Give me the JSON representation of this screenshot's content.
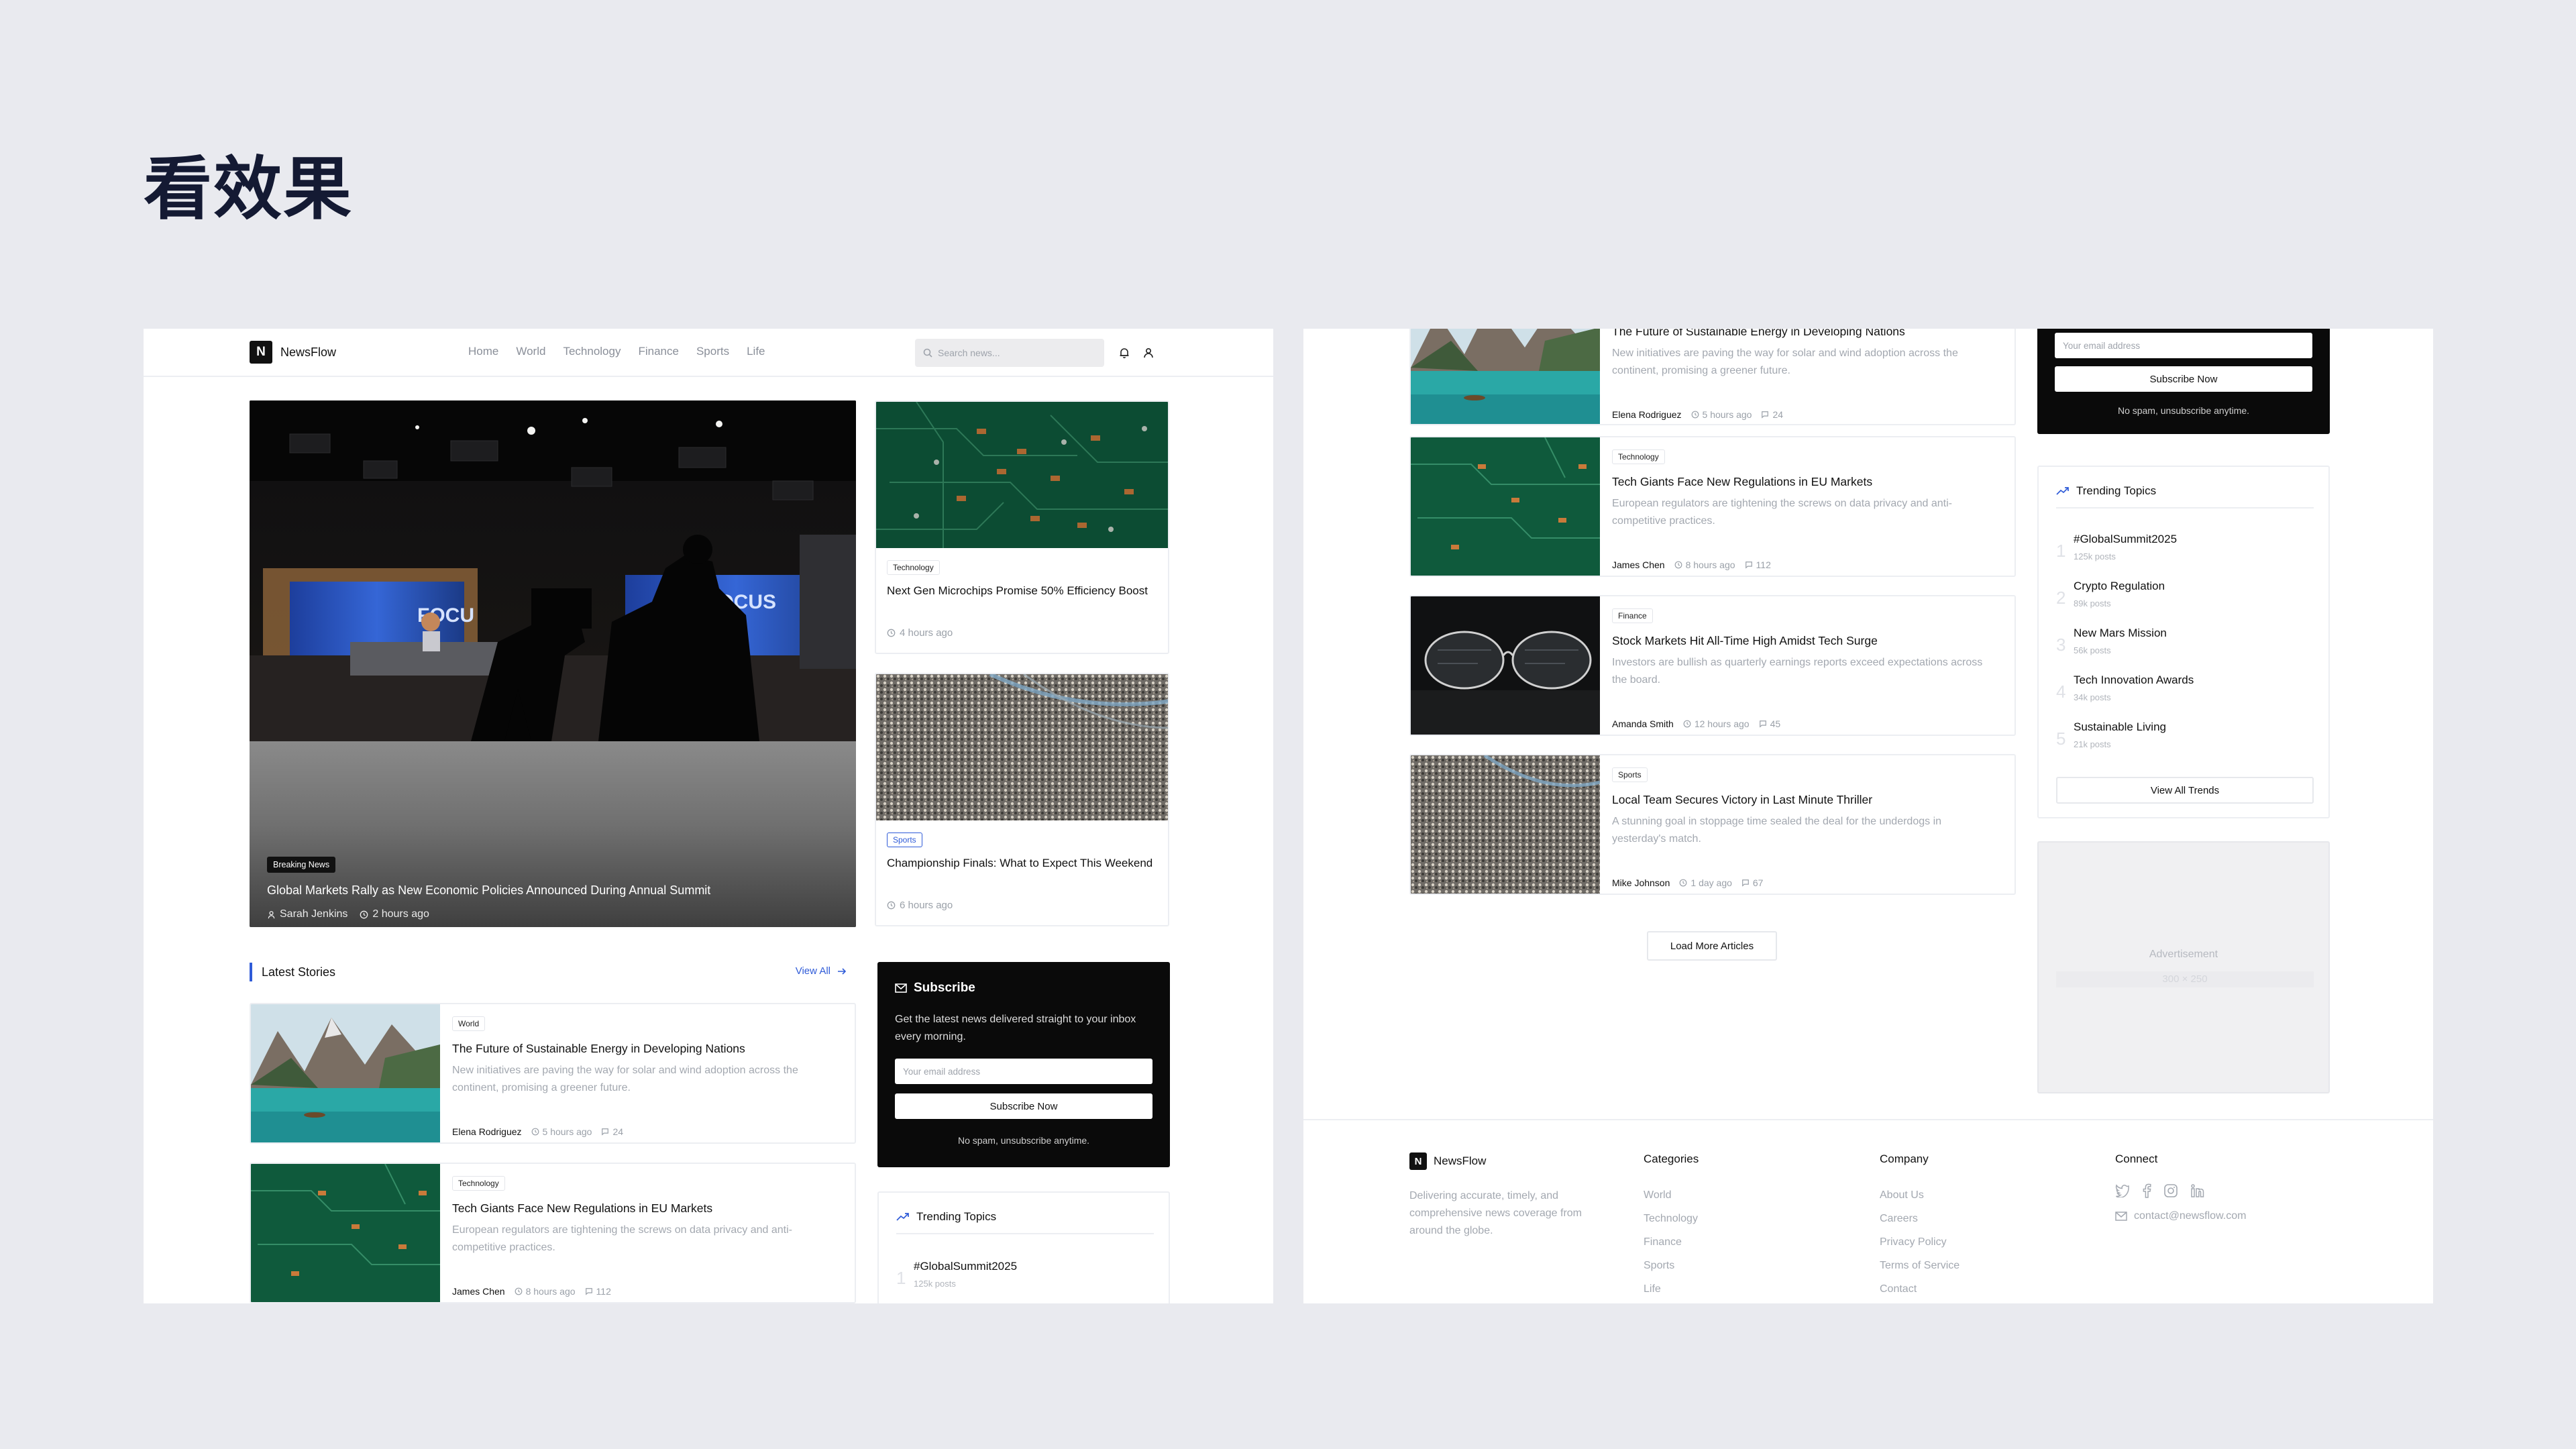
{
  "slide": {
    "title": "看效果"
  },
  "brand": {
    "logo_letter": "N",
    "name": "NewsFlow"
  },
  "nav": {
    "menu": [
      "Home",
      "World",
      "Technology",
      "Finance",
      "Sports",
      "Life"
    ],
    "search_placeholder": "Search news..."
  },
  "hero": {
    "badge": "Breaking News",
    "title": "Global Markets Rally as New Economic Policies Announced During Annual Summit",
    "author": "Sarah Jenkins",
    "time": "2 hours ago"
  },
  "side_cards": [
    {
      "tag": "Technology",
      "title": "Next Gen Microchips Promise 50% Efficiency Boost",
      "time": "4 hours ago"
    },
    {
      "tag": "Sports",
      "title": "Championship Finals: What to Expect This Weekend",
      "time": "6 hours ago"
    }
  ],
  "latest": {
    "heading": "Latest Stories",
    "view_all": "View All"
  },
  "articles": [
    {
      "tag": "World",
      "title": "The Future of Sustainable Energy in Developing Nations",
      "desc": "New initiatives are paving the way for solar and wind adoption across the continent, promising a greener future.",
      "author": "Elena Rodriguez",
      "time": "5 hours ago",
      "comments": "24"
    },
    {
      "tag": "Technology",
      "title": "Tech Giants Face New Regulations in EU Markets",
      "desc": "European regulators are tightening the screws on data privacy and anti-competitive practices.",
      "author": "James Chen",
      "time": "8 hours ago",
      "comments": "112"
    },
    {
      "tag": "Finance",
      "title": "Stock Markets Hit All-Time High Amidst Tech Surge",
      "desc": "Investors are bullish as quarterly earnings reports exceed expectations across the board.",
      "author": "Amanda Smith",
      "time": "12 hours ago",
      "comments": "45"
    },
    {
      "tag": "Sports",
      "title": "Local Team Secures Victory in Last Minute Thriller",
      "desc": "A stunning goal in stoppage time sealed the deal for the underdogs in yesterday's match.",
      "author": "Mike Johnson",
      "time": "1 day ago",
      "comments": "67"
    }
  ],
  "subscribe": {
    "heading": "Subscribe",
    "text": "Get the latest news delivered straight to your inbox every morning.",
    "email_placeholder": "Your email address",
    "button": "Subscribe Now",
    "note": "No spam, unsubscribe anytime."
  },
  "trending": {
    "heading": "Trending Topics",
    "items": [
      {
        "rank": "1",
        "name": "#GlobalSummit2025",
        "posts": "125k posts"
      },
      {
        "rank": "2",
        "name": "Crypto Regulation",
        "posts": "89k posts"
      },
      {
        "rank": "3",
        "name": "New Mars Mission",
        "posts": "56k posts"
      },
      {
        "rank": "4",
        "name": "Tech Innovation Awards",
        "posts": "34k posts"
      },
      {
        "rank": "5",
        "name": "Sustainable Living",
        "posts": "21k posts"
      }
    ],
    "view_all": "View All Trends"
  },
  "ad": {
    "label": "Advertisement",
    "size": "300 × 250"
  },
  "load_more": "Load More Articles",
  "footer": {
    "description": "Delivering accurate, timely, and comprehensive news coverage from around the globe.",
    "categories": {
      "heading": "Categories",
      "links": [
        "World",
        "Technology",
        "Finance",
        "Sports",
        "Life"
      ]
    },
    "company": {
      "heading": "Company",
      "links": [
        "About Us",
        "Careers",
        "Privacy Policy",
        "Terms of Service",
        "Contact"
      ]
    },
    "connect": {
      "heading": "Connect",
      "icons": [
        "twitter-icon",
        "facebook-icon",
        "instagram-icon",
        "linkedin-icon"
      ],
      "email": "contact@newsflow.com"
    }
  }
}
